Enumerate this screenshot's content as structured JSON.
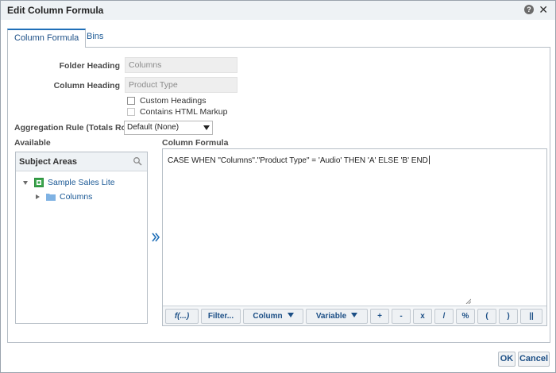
{
  "dialog": {
    "title": "Edit Column Formula",
    "help_glyph": "?",
    "close_glyph": "✕"
  },
  "tabs": [
    {
      "label": "Column Formula",
      "active": true
    },
    {
      "label": "Bins",
      "active": false
    }
  ],
  "form": {
    "folder_heading_label": "Folder Heading",
    "folder_heading_value": "Columns",
    "column_heading_label": "Column Heading",
    "column_heading_value": "Product Type",
    "custom_headings_label": "Custom Headings",
    "contains_html_label": "Contains HTML Markup",
    "aggregation_label": "Aggregation Rule (Totals Row)",
    "aggregation_value": "Default (None)"
  },
  "available": {
    "section_label": "Available",
    "panel_title": "Subject Areas",
    "tree": [
      {
        "label": "Sample Sales Lite",
        "expanded": true
      },
      {
        "label": "Columns",
        "expanded": false
      }
    ]
  },
  "formula": {
    "section_label": "Column Formula",
    "text": "CASE WHEN \"Columns\".\"Product Type\" = 'Audio' THEN 'A' ELSE 'B' END",
    "toolbar": {
      "fx": "f(...)",
      "filter": "Filter...",
      "column": "Column",
      "variable": "Variable",
      "plus": "+",
      "minus": "-",
      "times": "x",
      "divide": "/",
      "percent": "%",
      "open_paren": "(",
      "close_paren": ")",
      "concat": "||"
    }
  },
  "footer": {
    "ok": "OK",
    "cancel": "Cancel"
  },
  "colors": {
    "accent": "#1f6fb8",
    "link": "#1c5a96",
    "header_bg": "#eef2f5"
  }
}
